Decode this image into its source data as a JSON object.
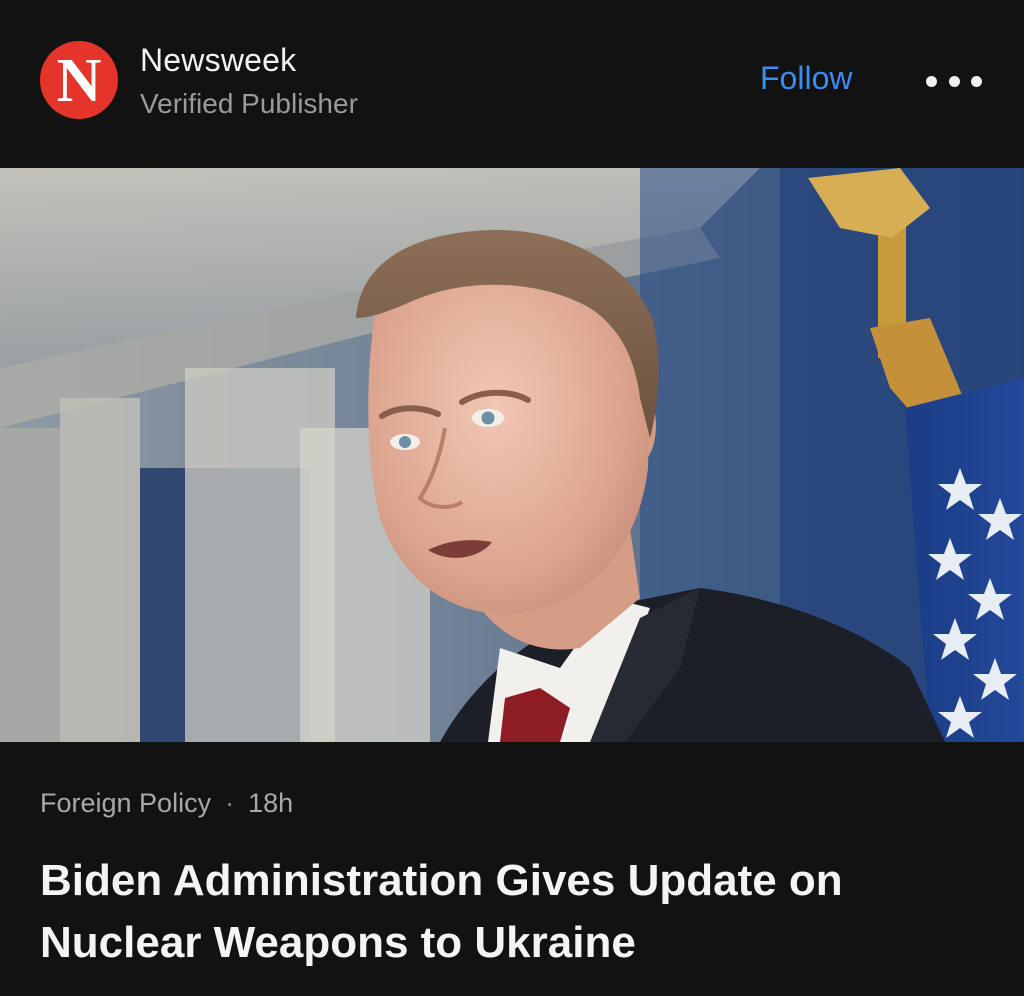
{
  "publisher": {
    "logo_letter": "N",
    "name": "Newsweek",
    "subtitle": "Verified Publisher",
    "follow_label": "Follow",
    "more_icon": "ellipsis-icon"
  },
  "article": {
    "category": "Foreign Policy",
    "separator": "·",
    "time": "18h",
    "headline": "Biden Administration Gives Update on Nuclear Weapons to Ukraine"
  },
  "colors": {
    "background": "#121212",
    "accent": "#3b8df5",
    "logo": "#e5352b"
  }
}
